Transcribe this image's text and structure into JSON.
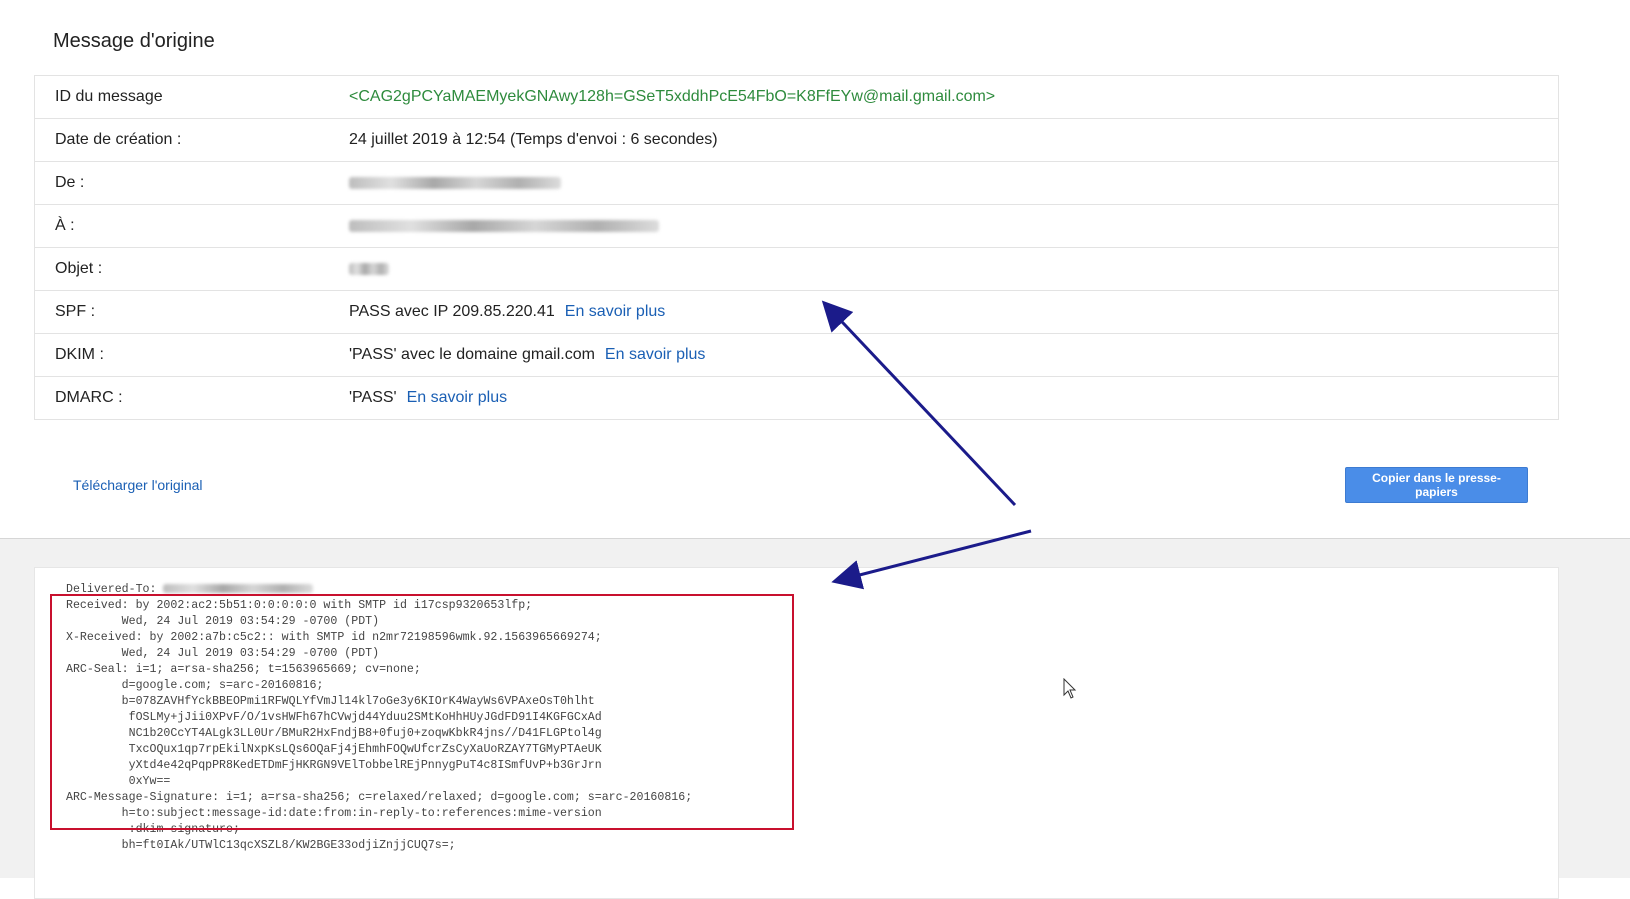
{
  "page_title": "Message d'origine",
  "info_rows": [
    {
      "label": "ID du message",
      "value": "<CAG2gPCYaMAEMyekGNAwy128h=GSeT5xddhPcE54FbO=K8FfEYw@mail.gmail.com>"
    },
    {
      "label": "Date de création :",
      "value": "24 juillet 2019 à 12:54 (Temps d'envoi : 6 secondes)"
    },
    {
      "label": "De :",
      "value": ""
    },
    {
      "label": "À :",
      "value": ""
    },
    {
      "label": "Objet :",
      "value": ""
    },
    {
      "label": "SPF :",
      "value": "PASS avec IP 209.85.220.41",
      "link": "En savoir plus"
    },
    {
      "label": "DKIM :",
      "value": "'PASS' avec le domaine gmail.com",
      "link": "En savoir plus"
    },
    {
      "label": "DMARC :",
      "value": "'PASS'",
      "link": "En savoir plus"
    }
  ],
  "download_link": "Télécharger l'original",
  "copy_button": "Copier dans le presse-papiers",
  "raw_source": [
    "Delivered-To: ",
    "Received: by 2002:ac2:5b51:0:0:0:0:0 with SMTP id i17csp9320653lfp;",
    "        Wed, 24 Jul 2019 03:54:29 -0700 (PDT)",
    "X-Received: by 2002:a7b:c5c2:: with SMTP id n2mr72198596wmk.92.1563965669274;",
    "        Wed, 24 Jul 2019 03:54:29 -0700 (PDT)",
    "ARC-Seal: i=1; a=rsa-sha256; t=1563965669; cv=none;",
    "        d=google.com; s=arc-20160816;",
    "        b=078ZAVHfYckBBEOPmi1RFWQLYfVmJl14kl7oGe3y6KIOrK4WayWs6VPAxeOsT0hlht",
    "         fOSLMy+jJii0XPvF/O/1vsHWFh67hCVwjd44Yduu2SMtKoHhHUyJGdFD91I4KGFGCxAd",
    "         NC1b20CcYT4ALgk3LL0Ur/BMuR2HxFndjB8+0fuj0+zoqwKbkR4jns//D41FLGPtol4g",
    "         TxcOQux1qp7rpEkilNxpKsLQs6OQaFj4jEhmhFOQwUfcrZsCyXaUoRZAY7TGMyPTAeUK",
    "         yXtd4e42qPqpPR8KedETDmFjHKRGN9VElTobbelREjPnnygPuT4c8ISmfUvP+b3GrJrn",
    "         0xYw==",
    "ARC-Message-Signature: i=1; a=rsa-sha256; c=relaxed/relaxed; d=google.com; s=arc-20160816;",
    "        h=to:subject:message-id:date:from:in-reply-to:references:mime-version",
    "         :dkim-signature;",
    "        bh=ft0IAk/UTWlC13qcXSZL8/KW2BGE33odjiZnjjCUQ7s=;"
  ]
}
